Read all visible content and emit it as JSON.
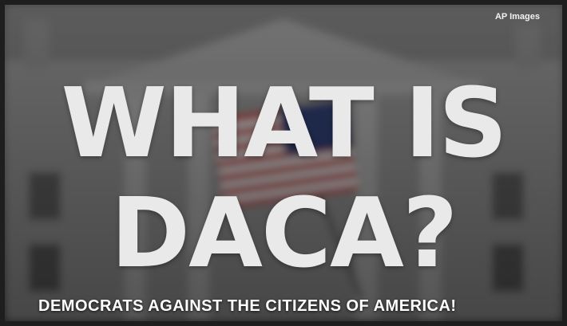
{
  "watermark": "AP Images",
  "headline": {
    "line1": "WHAT IS",
    "line2": "DACA?"
  },
  "caption": "DEMOCRATS AGAINST THE CITIZENS OF AMERICA!",
  "colors": {
    "headline": "#e9e9e9",
    "caption": "#ffffff",
    "flag_red": "#b23a3a",
    "flag_blue": "#2f3e6e"
  }
}
